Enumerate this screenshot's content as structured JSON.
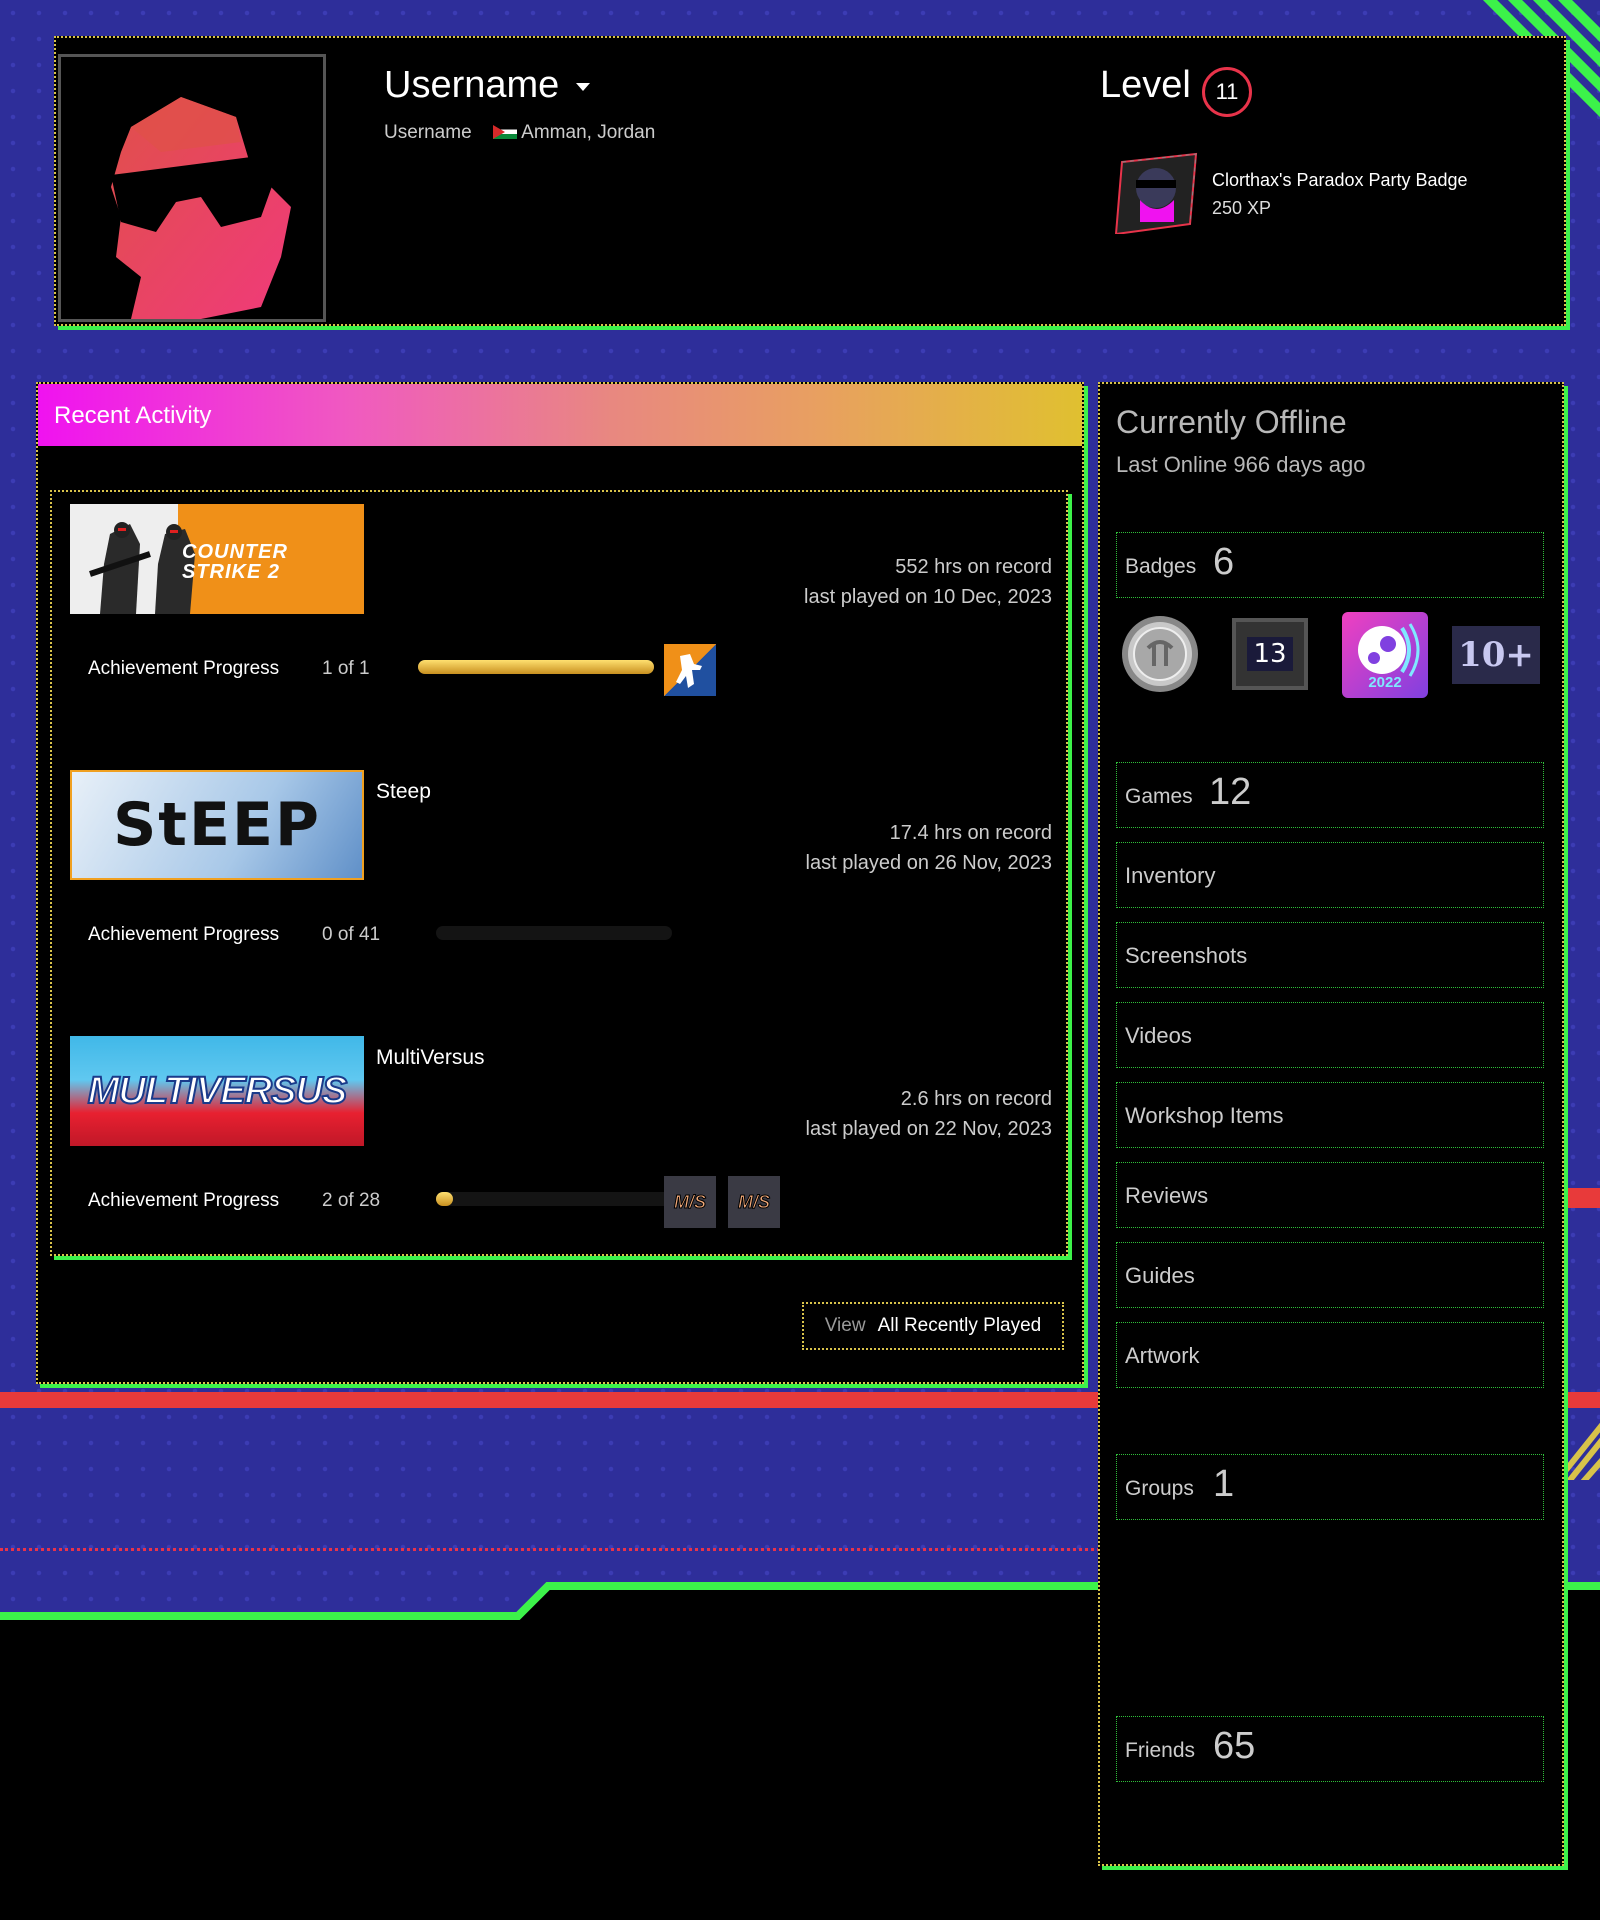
{
  "profile": {
    "username": "Username",
    "persona_name": "Username",
    "location": "Amman, Jordan",
    "level_label": "Level",
    "level": "11",
    "featured_badge": {
      "name": "Clorthax's Paradox Party Badge",
      "xp": "250 XP"
    }
  },
  "recent_activity": {
    "header": "Recent Activity",
    "games": [
      {
        "title": "",
        "capsule_text": "COUNTER STRIKE 2",
        "hours": "552 hrs on record",
        "last_played": "last played on 10 Dec, 2023",
        "progress_label": "Achievement Progress",
        "progress_count": "1 of 1",
        "progress": 1.0
      },
      {
        "title": "Steep",
        "capsule_text": "StEEP",
        "hours": "17.4 hrs on record",
        "last_played": "last played on 26 Nov, 2023",
        "progress_label": "Achievement Progress",
        "progress_count": "0 of 41",
        "progress": 0.0
      },
      {
        "title": "MultiVersus",
        "capsule_text": "MULTIVERSUS",
        "hours": "2.6 hrs on record",
        "last_played": "last played on 22 Nov, 2023",
        "progress_label": "Achievement Progress",
        "progress_count": "2 of 28",
        "progress": 0.0714
      }
    ],
    "achievement_icon_text": "M/S",
    "view_label": "View",
    "view_all_label": "All Recently Played"
  },
  "sidebar": {
    "status": "Currently Offline",
    "last_online": "Last Online 966 days ago",
    "badges_label": "Badges",
    "badges_count": "6",
    "badge_icons": [
      "13",
      "2022",
      "10+"
    ],
    "games_label": "Games",
    "games_count": "12",
    "links": [
      "Inventory",
      "Screenshots",
      "Videos",
      "Workshop Items",
      "Reviews",
      "Guides",
      "Artwork"
    ],
    "groups_label": "Groups",
    "groups_count": "1",
    "friends_label": "Friends",
    "friends_count": "65"
  },
  "colors": {
    "background": "#2e2e9a",
    "accent_green": "#3cf24a",
    "accent_yellow": "#d8c24a",
    "header_gradient_start": "#f012f0",
    "header_gradient_end": "#e0c030",
    "level_ring": "#e8334a",
    "stripe_red": "#e83a3a"
  }
}
